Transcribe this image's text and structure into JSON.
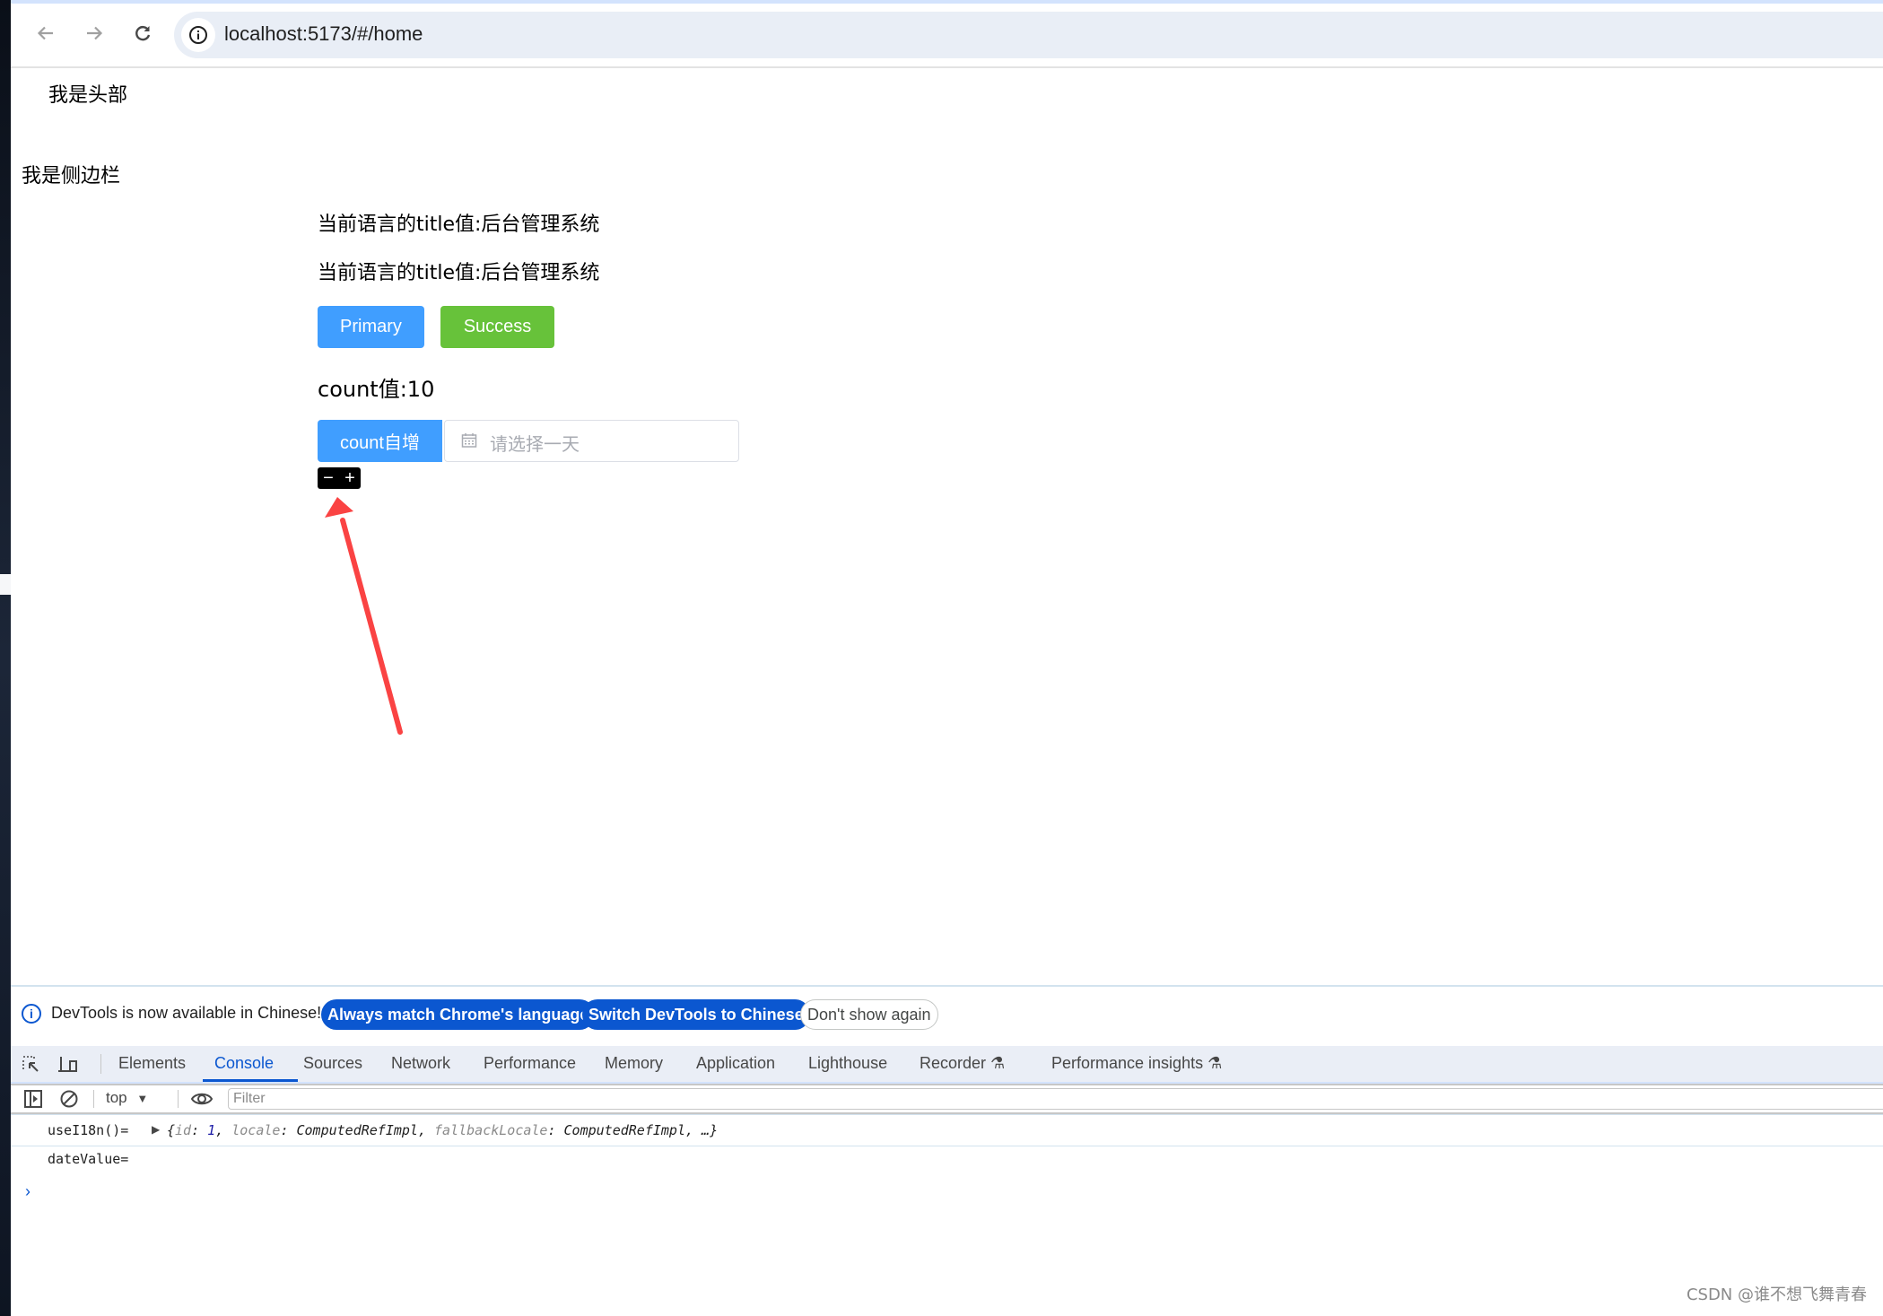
{
  "browser": {
    "url": "localhost:5173/#/home",
    "icons": {
      "back": "arrow-left-icon",
      "forward": "arrow-right-icon",
      "reload": "reload-icon",
      "site_info": "info-icon"
    }
  },
  "page": {
    "header_text": "我是头部",
    "sidebar_text": "我是侧边栏",
    "title_line_1": "当前语言的title值:后台管理系统",
    "title_line_2": "当前语言的title值:后台管理系统",
    "buttons": {
      "primary": "Primary",
      "success": "Success",
      "count_increment": "count自增"
    },
    "count_text": "count值:10",
    "date_picker": {
      "placeholder": "请选择一天",
      "value": ""
    },
    "stepper": {
      "minus": "−",
      "plus": "+"
    },
    "colors": {
      "primary": "#409eff",
      "success": "#67c23a",
      "annotation_arrow": "#fa4343"
    }
  },
  "devtools": {
    "infobar": {
      "message": "DevTools is now available in Chinese!",
      "actions": [
        "Always match Chrome's language",
        "Switch DevTools to Chinese",
        "Don't show again"
      ]
    },
    "tabs": [
      "Elements",
      "Console",
      "Sources",
      "Network",
      "Performance",
      "Memory",
      "Application",
      "Lighthouse",
      "Recorder",
      "Performance insights"
    ],
    "active_tab": "Console",
    "console_toolbar": {
      "context": "top",
      "filter_placeholder": "Filter"
    },
    "logs": [
      {
        "prefix": "useI18n()=",
        "object": {
          "open": "{",
          "k1": "id",
          "v1": "1",
          "k2": "locale",
          "v2": "ComputedRefImpl",
          "k3": "fallbackLocale",
          "v3": "ComputedRefImpl",
          "tail": ", …}"
        }
      },
      {
        "prefix": "dateValue="
      }
    ],
    "prompt": "›"
  },
  "watermark": "CSDN @谁不想飞舞青春"
}
